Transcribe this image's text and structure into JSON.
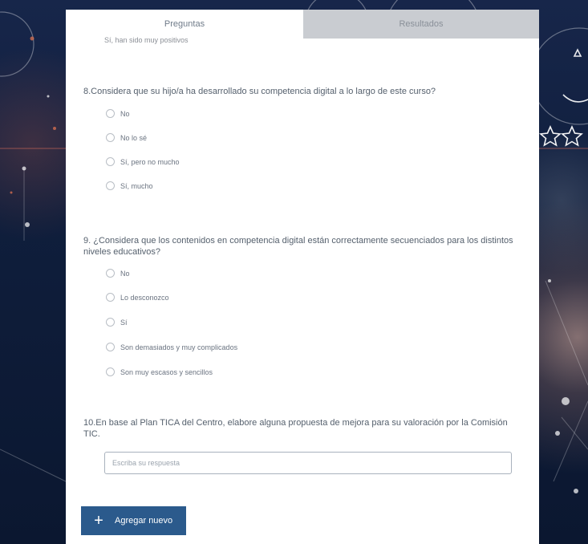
{
  "colors": {
    "accent": "#2b5a8c",
    "tab_inactive": "#c9ccd1",
    "background": "#0f1b33"
  },
  "tabs": [
    {
      "label": "Preguntas",
      "active": true
    },
    {
      "label": "Resultados",
      "active": false
    }
  ],
  "form": {
    "previous_option_residual": "Sí, han sido muy positivos",
    "questions": [
      {
        "text": "8.Considera que su hijo/a ha desarrollado su competencia digital a lo largo de este curso?",
        "options": [
          "No",
          "No lo sé",
          "Sí, pero no mucho",
          "Sí, mucho"
        ]
      },
      {
        "text": "9. ¿Considera que los contenidos en competencia digital están correctamente secuenciados para los distintos niveles educativos?",
        "options": [
          "No",
          "Lo desconozco",
          "Sí",
          "Son demasiados y muy complicados",
          "Son muy escasos y sencillos"
        ]
      },
      {
        "text": "10.En base al Plan TICA del Centro, elabore alguna propuesta de mejora para su valoración por la Comisión TIC.",
        "input_placeholder": "Escriba su respuesta",
        "input_value": ""
      }
    ]
  },
  "add_button": {
    "icon": "plus-icon",
    "label": "Agregar nuevo"
  }
}
